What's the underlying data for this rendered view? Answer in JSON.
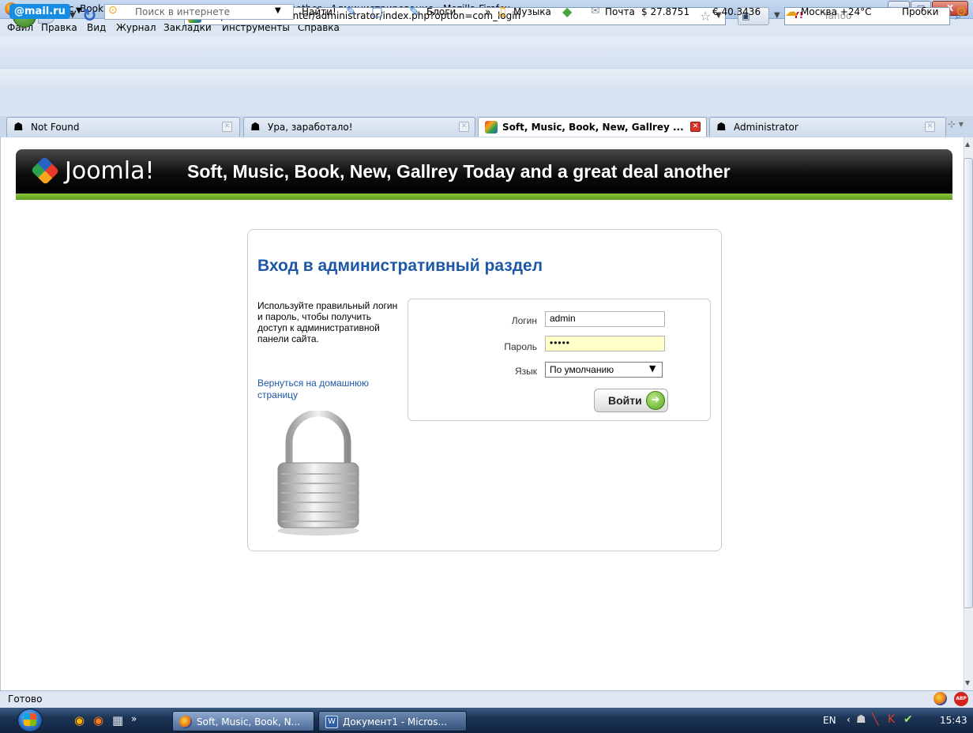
{
  "window": {
    "title": "Soft, Music, Book, New, Gallrey Today and a great deal another - Администрирование - Mozilla Firefox",
    "controls": {
      "minimize": "—",
      "maximize": "□",
      "close": "X"
    }
  },
  "menu": [
    "Файл",
    "Правка",
    "Вид",
    "Журнал",
    "Закладки",
    "Инструменты",
    "Справка"
  ],
  "navbar": {
    "url": "http://localhost/center/administrator/index.php?option=com_login",
    "search_placeholder": "Yahoo",
    "search_engine": "Y!"
  },
  "mailru_toolbar": {
    "logo": "@mail.ru",
    "search_placeholder": "Поиск в интернете",
    "find_button": "Найти!",
    "blogs": "Блоги",
    "music": "Музыка",
    "mail": "Почта",
    "usd_rate": "$ 27.8751",
    "eur_rate": "€ 40.3436",
    "weather": "Москва +24°C",
    "traffic": "Пробки"
  },
  "tabs": [
    {
      "label": "Not Found",
      "active": false
    },
    {
      "label": "Ура, заработало!",
      "active": false
    },
    {
      "label": "Soft, Music, Book, New, Gallrey ...",
      "active": true
    },
    {
      "label": "Administrator",
      "active": false
    }
  ],
  "page": {
    "brand": "Joomla!",
    "site_title": "Soft, Music, Book, New, Gallrey Today and a great deal another",
    "login": {
      "heading": "Вход в административный раздел",
      "help_text": "Используйте правильный логин и пароль, чтобы получить доступ к административной панели сайта.",
      "home_link": "Вернуться на домашнюю страницу",
      "username_label": "Логин",
      "username_value": "admin",
      "password_label": "Пароль",
      "password_value": "•••••",
      "language_label": "Язык",
      "language_value": "По умолчанию",
      "submit_label": "Войти"
    }
  },
  "status": {
    "text": "Готово",
    "abp": "ABP"
  },
  "taskbar": {
    "items": [
      {
        "label": "Soft, Music, Book, N...",
        "active": true
      },
      {
        "label": "Документ1 - Micros...",
        "active": false
      }
    ],
    "language": "EN",
    "clock": "15:43"
  },
  "colors": {
    "link_blue": "#1d57a8",
    "joomla_green": "#8cc63f",
    "header_black": "#0d0d0d",
    "password_bg": "#ffffc8"
  }
}
